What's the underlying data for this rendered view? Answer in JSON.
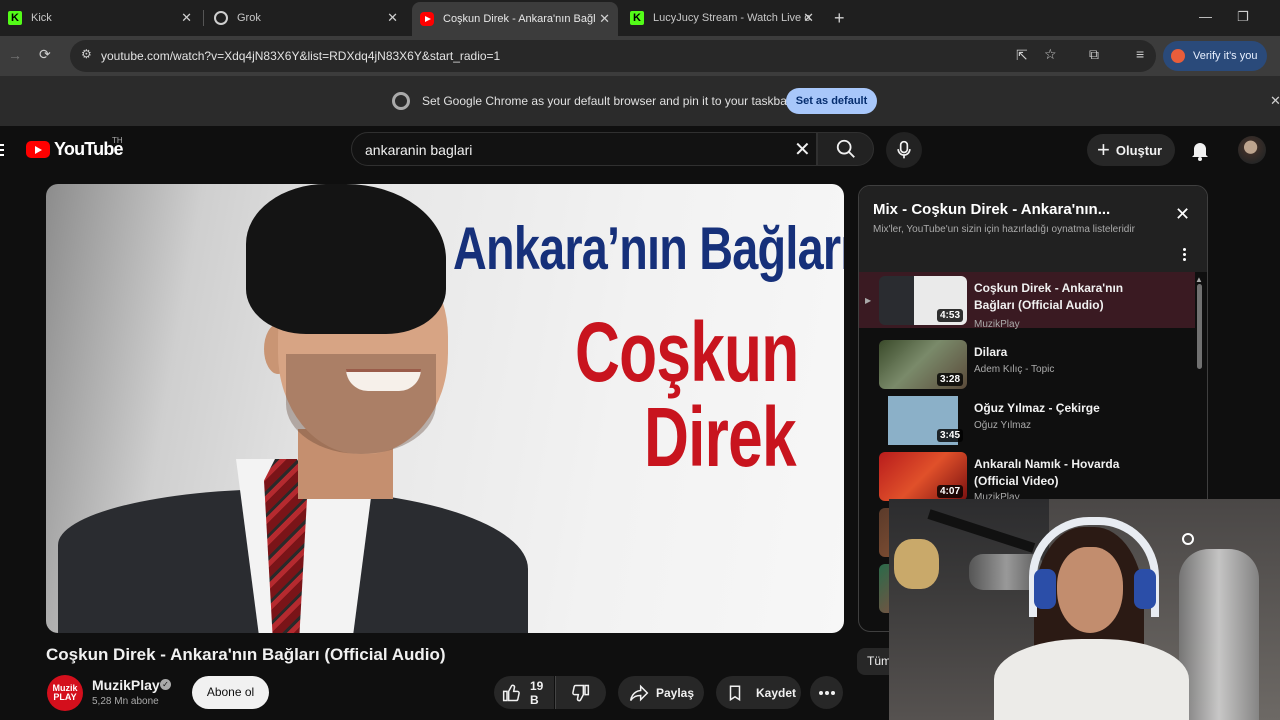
{
  "browser": {
    "tabs": [
      {
        "title": "Kick",
        "favicon": "kick-icon",
        "active": false
      },
      {
        "title": "Grok",
        "favicon": "grok-icon",
        "active": false
      },
      {
        "title": "Coşkun Direk - Ankara'nın Bağl",
        "favicon": "youtube-icon",
        "active": true
      },
      {
        "title": "LucyJucy Stream - Watch Live o",
        "favicon": "kick-icon",
        "active": false
      }
    ],
    "url": "youtube.com/watch?v=Xdq4jN83X6Y&list=RDXdq4jN83X6Y&start_radio=1",
    "verify_label": "Verify it's you",
    "infobar_message": "Set Google Chrome as your default browser and pin it to your taskbar",
    "infobar_button": "Set as default"
  },
  "youtube": {
    "logo_text": "YouTube",
    "country_code": "TH",
    "search_query": "ankaranin baglari",
    "create_label": "Oluştur"
  },
  "video": {
    "thumbnail_title": "Ankara’nın Bağları",
    "thumbnail_artist_line1": "Coşkun",
    "thumbnail_artist_line2": "Direk",
    "title": "Coşkun Direk - Ankara'nın Bağları (Official Audio)",
    "channel_name": "MuzikPlay",
    "channel_logo_text": "Muzik PLAY",
    "subscribers": "5,28 Mn abone",
    "subscribe_label": "Abone ol",
    "likes": "19 B",
    "share_label": "Paylaş",
    "save_label": "Kaydet"
  },
  "playlist": {
    "title": "Mix - Coşkun Direk - Ankara'nın...",
    "subtitle": "Mix'ler, YouTube'un sizin için hazırladığı oynatma listeleridir",
    "items": [
      {
        "title": "Coşkun Direk - Ankara'nın Bağları (Official Audio)",
        "channel": "MuzikPlay",
        "duration": "4:53",
        "active": true
      },
      {
        "title": "Dilara",
        "channel": "Adem Kılıç - Topic",
        "duration": "3:28",
        "active": false
      },
      {
        "title": "Oğuz Yılmaz - Çekirge",
        "channel": "Oğuz Yılmaz",
        "duration": "3:45",
        "active": false
      },
      {
        "title": "Ankaralı Namık - Hovarda (Official Video)",
        "channel": "MuzikPlay",
        "duration": "4:07",
        "active": false
      }
    ]
  },
  "chip_label": "Tüm"
}
